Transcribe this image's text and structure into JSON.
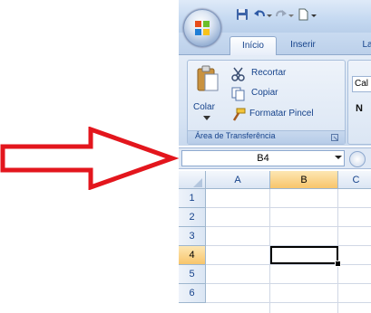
{
  "colors": {
    "arrow": "#e3161d",
    "ribbon_text": "#15428b",
    "selection_header": "#f8c56b"
  },
  "quick_access": {
    "icons": [
      "save-icon",
      "undo-icon",
      "redo-icon",
      "new-document-icon"
    ]
  },
  "tabs": [
    {
      "label": "Início",
      "active": true
    },
    {
      "label": "Inserir",
      "active": false
    },
    {
      "label": "La",
      "active": false
    }
  ],
  "clipboard_group": {
    "paste_label": "Colar",
    "cut_label": "Recortar",
    "copy_label": "Copiar",
    "format_painter_label": "Formatar Pincel",
    "group_label": "Área de Transferência"
  },
  "font_group": {
    "font_partial": "Cal",
    "bold_partial": "N"
  },
  "formula_bar": {
    "name_box": "B4"
  },
  "spreadsheet": {
    "columns": [
      "A",
      "B",
      "C"
    ],
    "rows": [
      "1",
      "2",
      "3",
      "4",
      "5",
      "6"
    ],
    "selected_column": "B",
    "selected_row": "4"
  }
}
